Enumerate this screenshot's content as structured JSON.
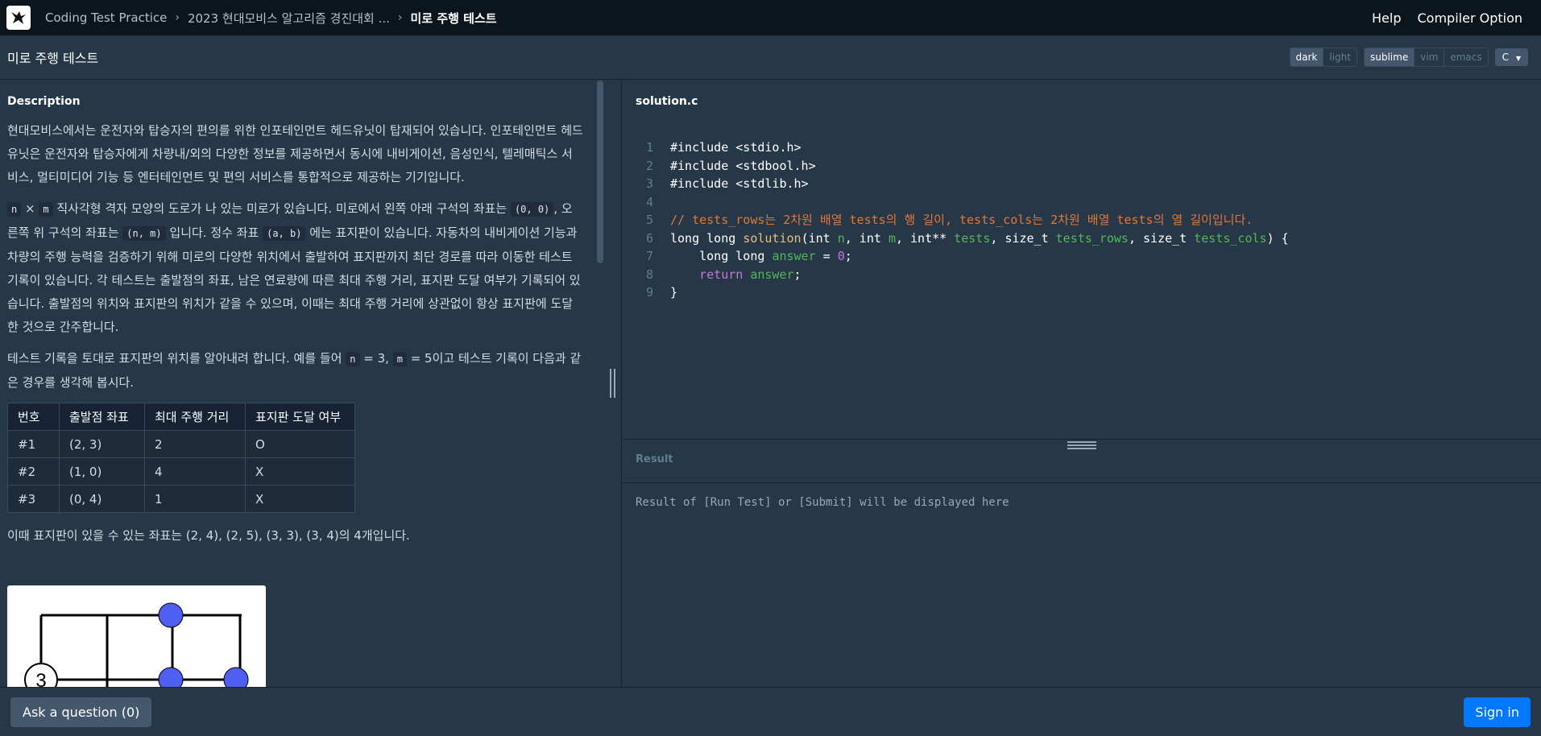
{
  "nav": {
    "breadcrumbs": [
      "Coding Test Practice",
      "2023 현대모비스 알고리즘 경진대회 ...",
      "미로 주행 테스트"
    ],
    "help": "Help",
    "compiler_option": "Compiler Option"
  },
  "header": {
    "title": "미로 주행 테스트",
    "theme": [
      "dark",
      "light"
    ],
    "keymap": [
      "sublime",
      "vim",
      "emacs"
    ],
    "language": "C"
  },
  "description": {
    "heading": "Description",
    "p1": "현대모비스에서는 운전자와 탑승자의 편의를 위한 인포테인먼트 헤드유닛이 탑재되어 있습니다. 인포테인먼트 헤드유닛은 운전자와 탑승자에게 차량내/외의 다양한 정보를 제공하면서 동시에 내비게이션, 음성인식, 텔레매틱스 서비스, 멀티미디어 기능 등 엔터테인먼트 및 편의 서비스를 통합적으로 제공하는 기기입니다.",
    "p2": {
      "code_n": "n",
      "times": "×",
      "code_m": "m",
      "t1": " 직사각형 격자 모양의 도로가 나 있는 미로가 있습니다. 미로에서 왼쪽 아래 구석의 좌표는 ",
      "code_origin": "(0, 0)",
      "t2": ", 오른쪽 위 구석의 좌표는 ",
      "code_nm": "(n, m)",
      "t3": " 입니다. 정수 좌표 ",
      "code_ab": "(a, b)",
      "t4": " 에는 표지판이 있습니다. 자동차의 내비게이션 기능과 차량의 주행 능력을 검증하기 위해 미로의 다양한 위치에서 출발하여 표지판까지 최단 경로를 따라 이동한 테스트 기록이 있습니다. 각 테스트는 출발점의 좌표, 남은 연료량에 따른 최대 주행 거리, 표지판 도달 여부가 기록되어 있습니다. 출발점의 위치와 표지판의 위치가 같을 수 있으며, 이때는 최대 주행 거리에 상관없이 항상 표지판에 도달한 것으로 간주합니다."
    },
    "p3": {
      "t1": "테스트 기록을 토대로 표지판의 위치를 알아내려 합니다. 예를 들어 ",
      "code_n": "n",
      "t2": " = 3, ",
      "code_m": "m",
      "t3": " = 5이고 테스트 기록이 다음과 같은 경우를 생각해 봅시다."
    },
    "table": {
      "headers": [
        "번호",
        "출발점 좌표",
        "최대 주행 거리",
        "표지판 도달 여부"
      ],
      "rows": [
        [
          "#1",
          "(2, 3)",
          "2",
          "O"
        ],
        [
          "#2",
          "(1, 0)",
          "4",
          "X"
        ],
        [
          "#3",
          "(0, 4)",
          "1",
          "X"
        ]
      ]
    },
    "p4": "이때 표지판이 있을 수 있는 좌표는 (2, 4), (2, 5), (3, 3), (3, 4)의 4개입니다.",
    "figure_label": "3"
  },
  "editor": {
    "filename": "solution.c",
    "line_numbers": [
      "1",
      "2",
      "3",
      "4",
      "5",
      "6",
      "7",
      "8",
      "9"
    ],
    "line1": "#include <stdio.h>",
    "line2": "#include <stdbool.h>",
    "line3": "#include <stdlib.h>",
    "line5": "// tests_rows는 2차원 배열 tests의 행 길이, tests_cols는 2차원 배열 tests의 열 길이입니다.",
    "line6": {
      "t1": "long long ",
      "fn": "solution",
      "t2": "(int ",
      "v1": "n",
      "t3": ", int ",
      "v2": "m",
      "t4": ", int** ",
      "v3": "tests",
      "t5": ", size_t ",
      "v4": "tests_rows",
      "t6": ", size_t ",
      "v5": "tests_cols",
      "t7": ") {"
    },
    "line7": {
      "t1": "    long long ",
      "v1": "answer",
      "t2": " = ",
      "num": "0",
      "t3": ";"
    },
    "line8": {
      "kw": "    return ",
      "v1": "answer",
      "t1": ";"
    },
    "line9": "}"
  },
  "result": {
    "label": "Result",
    "message": "Result of [Run Test] or [Submit] will be displayed here"
  },
  "footer": {
    "ask": "Ask a question (0)",
    "signin": "Sign in"
  },
  "colors": {
    "background": "#263747",
    "topbar": "#0c151c",
    "accent": "#0078ff",
    "figure_node": "#4f5ff2"
  }
}
